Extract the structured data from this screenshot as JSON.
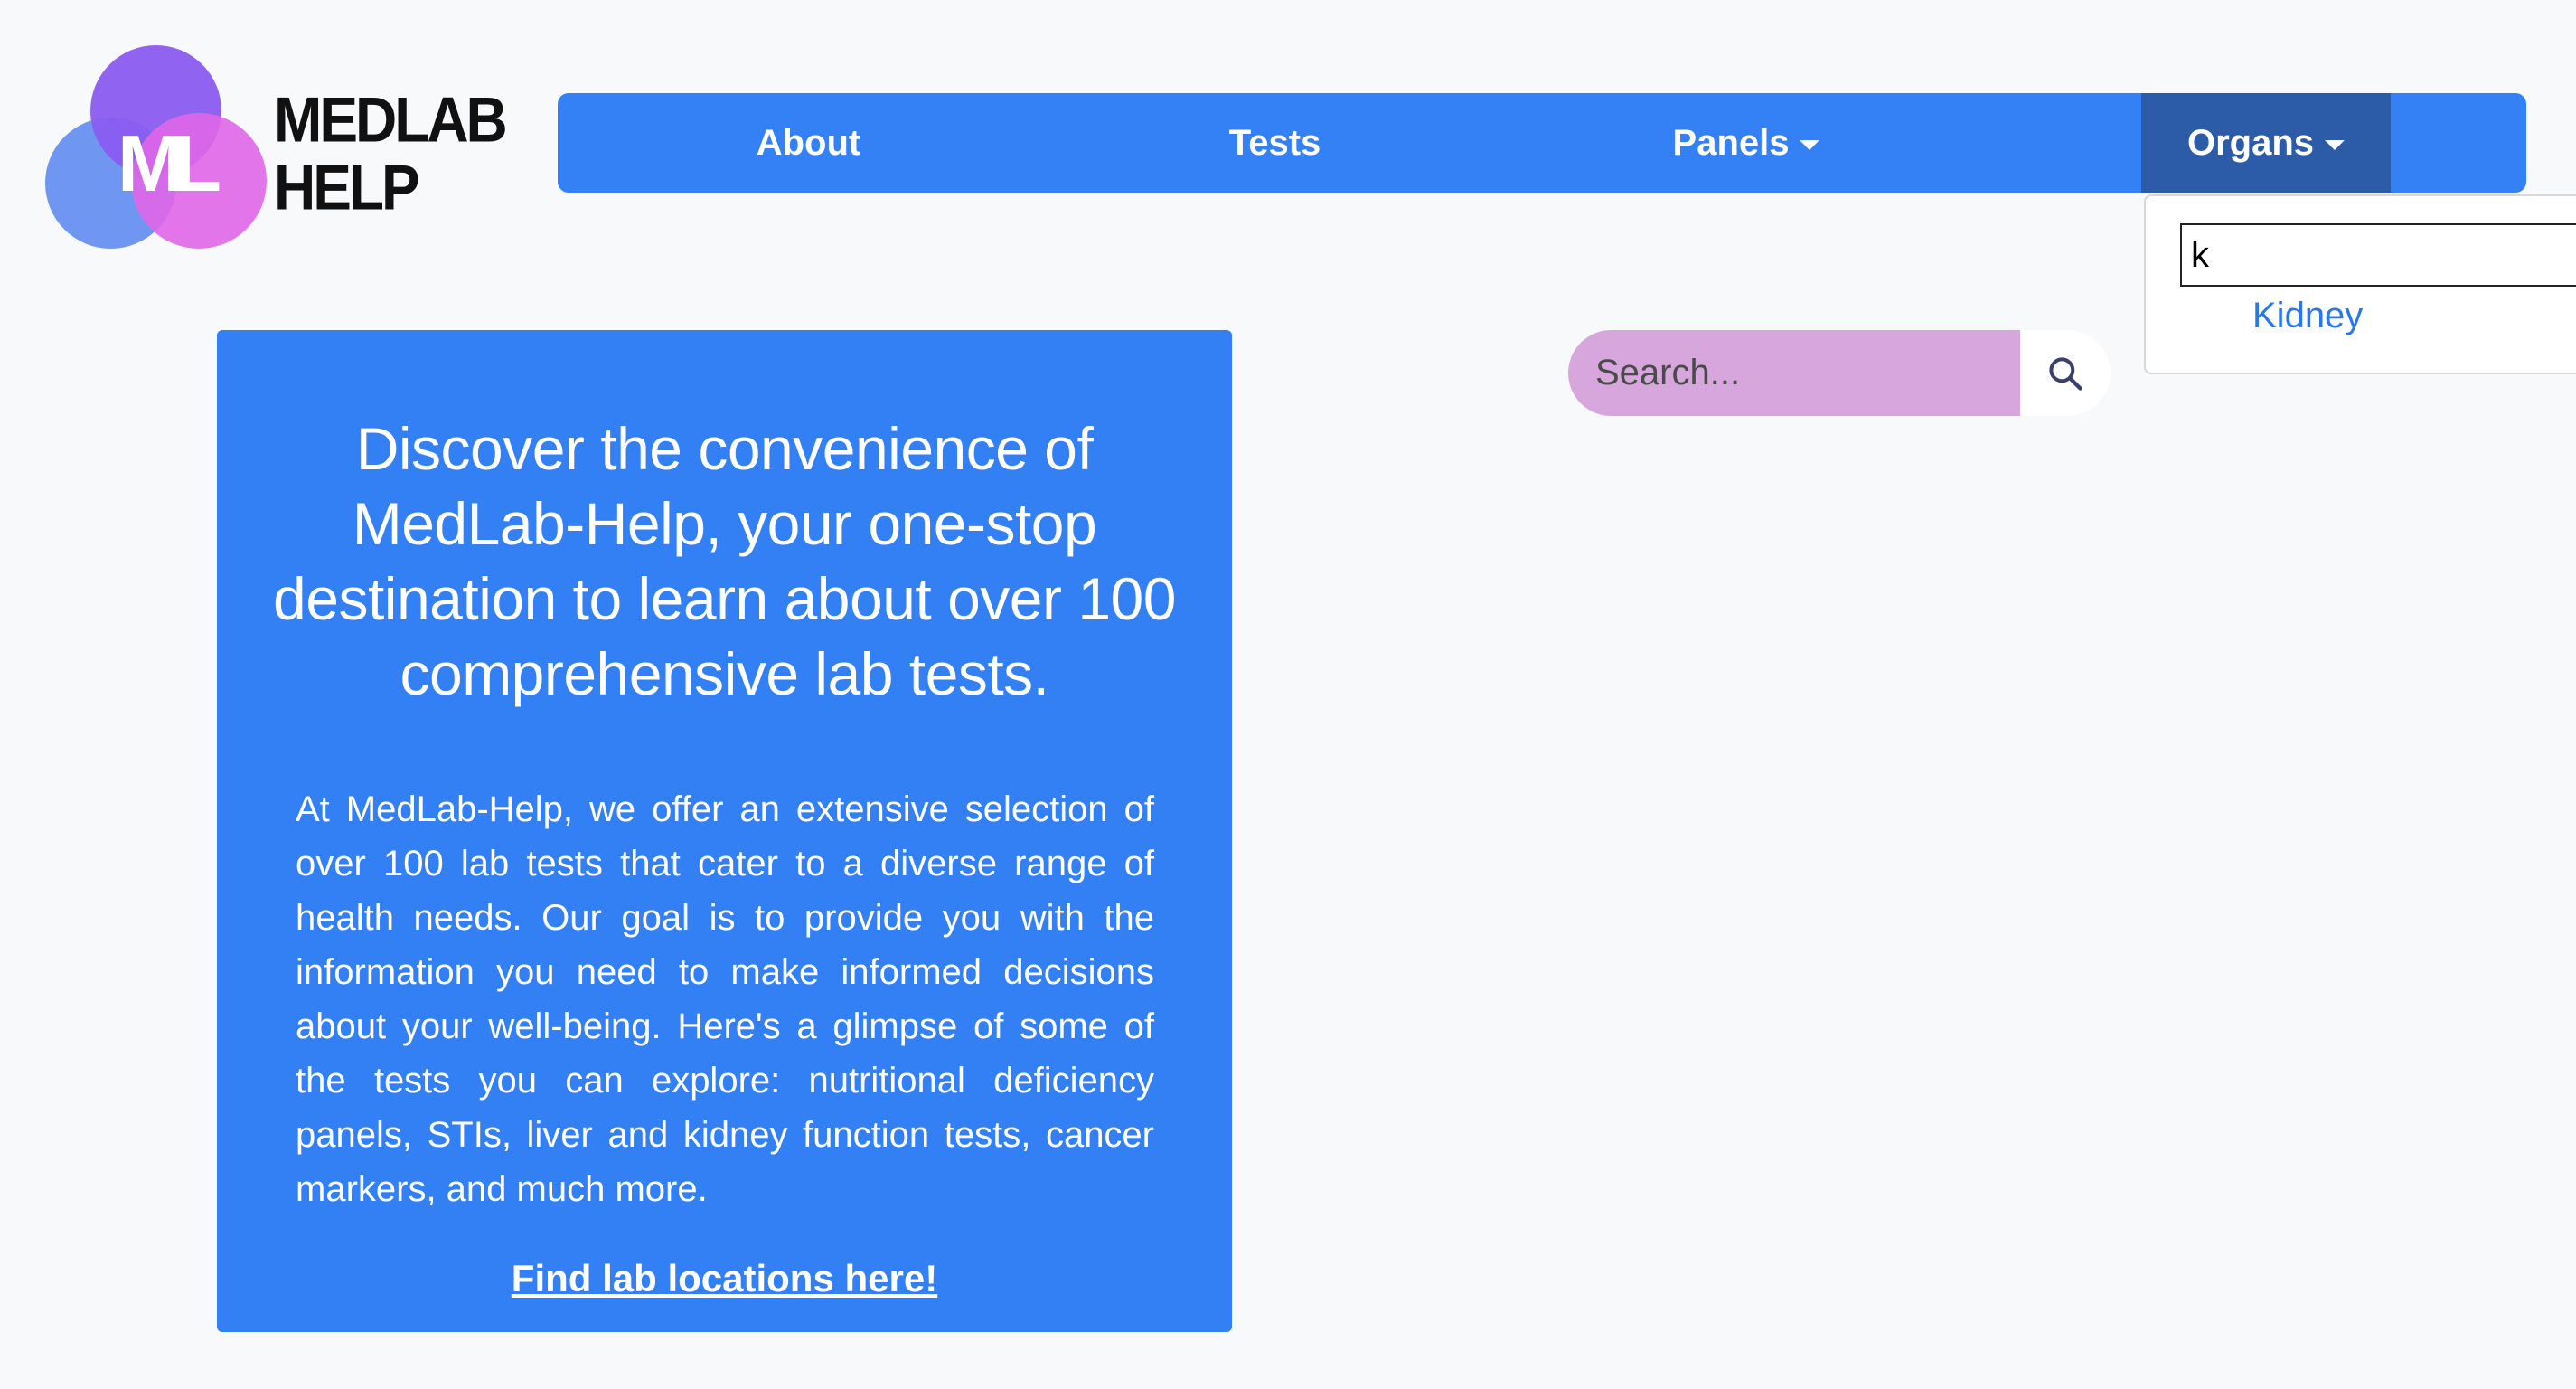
{
  "logo": {
    "monogram": "ML",
    "line1": "MEDLAB",
    "line2": "HELP"
  },
  "nav": {
    "about": "About",
    "tests": "Tests",
    "panels": "Panels",
    "organs": "Organs"
  },
  "organs_dropdown": {
    "input_value": "k",
    "result": "Kidney"
  },
  "search": {
    "placeholder": "Search...",
    "icon": "search-icon"
  },
  "hero": {
    "title": "Discover the convenience of MedLab-Help, your one-stop destination to learn about over 100 comprehensive lab tests.",
    "body": "At MedLab-Help, we offer an extensive selection of over 100 lab tests that cater to a diverse range of health needs. Our goal is to provide you with the information you need to make informed decisions about your well-being. Here's a glimpse of some of the tests you can explore: nutritional deficiency panels, STIs, liver and kidney function tests, cancer markers, and much more.",
    "link": "Find lab locations here!"
  },
  "colors": {
    "navbar": "#3480f5",
    "nav_active": "#2c5ca8",
    "hero": "#3380f5",
    "search_bg": "#d6a6dc",
    "link_blue": "#2a78e8"
  }
}
